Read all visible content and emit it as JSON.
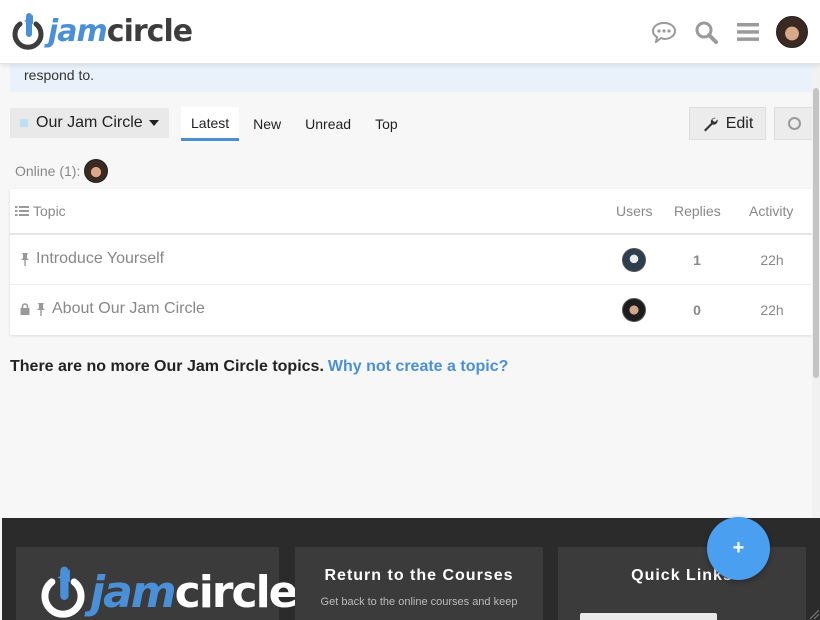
{
  "header": {
    "logo_jam": "jam",
    "logo_circle": "circle",
    "icons": [
      "chat-icon",
      "search-icon",
      "hamburger-menu-icon"
    ],
    "brand_color": "#4a90d9"
  },
  "notice": {
    "text": "respond to."
  },
  "navbar": {
    "category": "Our Jam Circle",
    "tabs": [
      {
        "label": "Latest",
        "active": true
      },
      {
        "label": "New",
        "active": false
      },
      {
        "label": "Unread",
        "active": false
      },
      {
        "label": "Top",
        "active": false
      }
    ],
    "edit_label": "Edit"
  },
  "online": {
    "label": "Online (1):"
  },
  "table": {
    "headers": {
      "topic": "Topic",
      "users": "Users",
      "replies": "Replies",
      "activity": "Activity"
    },
    "rows": [
      {
        "title": "Introduce Yourself",
        "pinned": true,
        "locked": false,
        "replies": "1",
        "activity": "22h"
      },
      {
        "title": "About Our Jam Circle",
        "pinned": true,
        "locked": true,
        "replies": "0",
        "activity": "22h"
      }
    ]
  },
  "no_more": {
    "text": "There are no more Our Jam Circle topics.",
    "link": "Why not create a topic?"
  },
  "footer": {
    "logo_jam": "jam",
    "logo_circle": "circle",
    "courses_title": "Return to the Courses",
    "courses_text": "Get back to the online courses and keep",
    "quick_title": "Quick Links"
  },
  "fab": {
    "label": "+"
  }
}
